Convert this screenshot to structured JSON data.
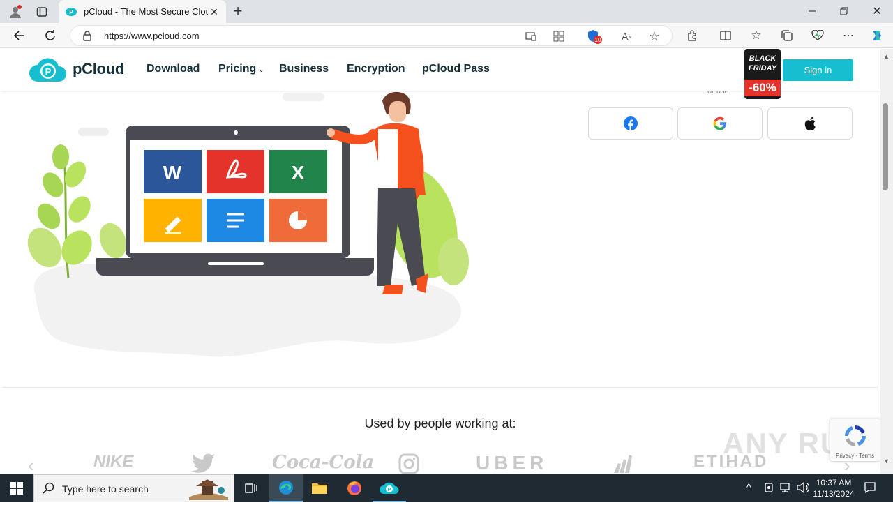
{
  "browser": {
    "tab_title": "pCloud - The Most Secure Cloud",
    "url": "https://www.pcloud.com",
    "extensions_badge": "10"
  },
  "header": {
    "logo_text": "pCloud",
    "nav": [
      "Download",
      "Pricing",
      "Business",
      "Encryption",
      "pCloud Pass"
    ],
    "sign_in": "Sign in",
    "promo": {
      "line1": "BLACK",
      "line2": "FRIDAY",
      "discount": "-60%"
    }
  },
  "login": {
    "or_use": "or use",
    "social": [
      "facebook-icon",
      "google-icon",
      "apple-icon"
    ]
  },
  "illustration": {
    "tiles": [
      "W",
      "",
      "X",
      "",
      "",
      ""
    ]
  },
  "clients": {
    "heading": "Used by people working at:",
    "brands": [
      "NIKE",
      "twitter",
      "Coca-Cola",
      "instagram",
      "UBER",
      "adidas",
      "ETIHAD"
    ]
  },
  "recaptcha": {
    "text": "Privacy - Terms"
  },
  "watermark": "ANY RUN",
  "taskbar": {
    "search_placeholder": "Type here to search",
    "time": "10:37 AM",
    "date": "11/13/2024"
  },
  "colors": {
    "accent": "#17bed0",
    "dark": "#17313b",
    "promo": "#e4332b"
  }
}
